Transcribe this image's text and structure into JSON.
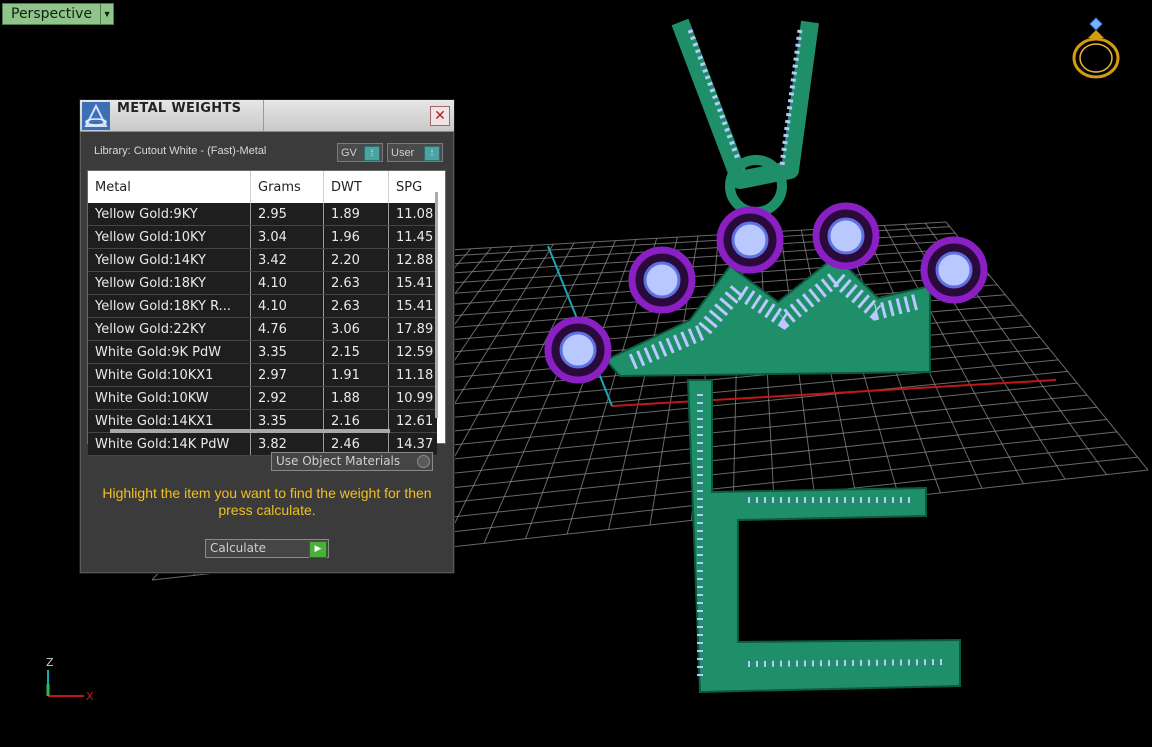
{
  "viewport": {
    "view_label": "Perspective",
    "view_dropdown_icon": "chevron-down-icon",
    "axis_labels": {
      "z": "Z",
      "x": "X"
    },
    "colors": {
      "grid": "#8c8c8c",
      "metal": "#1f8f6a",
      "stones": "#b9c8ff",
      "prongs": "#8a1fc4",
      "x_axis": "#c01818",
      "y_axis": "#1aa6b4"
    }
  },
  "panel": {
    "title": "METAL WEIGHTS",
    "close_glyph": "✕",
    "library_label": "Library: Cutout White - (Fast)-Metal",
    "gv_label": "GV",
    "user_label": "User",
    "toggle_glyph": "⁞",
    "table": {
      "headers": [
        "Metal",
        "Grams",
        "DWT",
        "SPG"
      ],
      "rows": [
        [
          "Yellow Gold:9KY",
          "2.95",
          "1.89",
          "11.08"
        ],
        [
          "Yellow Gold:10KY",
          "3.04",
          "1.96",
          "11.45"
        ],
        [
          "Yellow Gold:14KY",
          "3.42",
          "2.20",
          "12.88"
        ],
        [
          "Yellow Gold:18KY",
          "4.10",
          "2.63",
          "15.41"
        ],
        [
          "Yellow Gold:18KY R...",
          "4.10",
          "2.63",
          "15.41"
        ],
        [
          "Yellow Gold:22KY",
          "4.76",
          "3.06",
          "17.89"
        ],
        [
          "White Gold:9K PdW",
          "3.35",
          "2.15",
          "12.59"
        ],
        [
          "White Gold:10KX1",
          "2.97",
          "1.91",
          "11.18"
        ],
        [
          "White Gold:10KW",
          "2.92",
          "1.88",
          "10.99"
        ],
        [
          "White Gold:14KX1",
          "3.35",
          "2.16",
          "12.61"
        ],
        [
          "White Gold:14K PdW",
          "3.82",
          "2.46",
          "14.37"
        ]
      ]
    },
    "use_object_materials_label": "Use Object Materials",
    "hint_text": "Highlight the item you want to find the weight for then press calculate.",
    "calculate_label": "Calculate",
    "calculate_glyph": "▶"
  }
}
